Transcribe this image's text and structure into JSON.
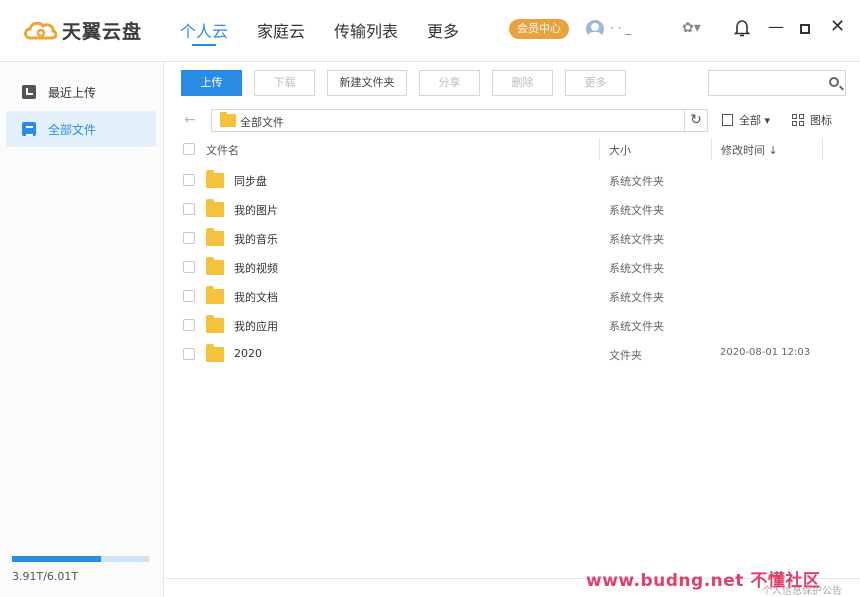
{
  "app": {
    "logo_text": "天翼云盘"
  },
  "nav": {
    "items": [
      "个人云",
      "家庭云",
      "传输列表",
      "更多"
    ]
  },
  "header": {
    "vip_label": "会员中心",
    "username": "· ·  _",
    "skin_icon": "✿▾",
    "min_icon": "—",
    "close_icon": "✕"
  },
  "sidebar": {
    "items": [
      {
        "label": "最近上传"
      },
      {
        "label": "全部文件"
      }
    ],
    "storage": {
      "text": "3.91T/6.01T",
      "used_fraction": 0.65
    }
  },
  "toolbar": {
    "upload": "上传",
    "download": "下载",
    "new_folder": "新建文件夹",
    "share": "分享",
    "delete": "删除",
    "more": "更多"
  },
  "path": {
    "current": "全部文件",
    "refresh_icon": "↻"
  },
  "view": {
    "filter_label": "全部 ▾",
    "mode_label": "图标"
  },
  "table": {
    "headers": {
      "name": "文件名",
      "size": "大小",
      "modified": "修改时间 ↓"
    },
    "rows": [
      {
        "name": "同步盘",
        "type": "系统文件夹",
        "time": ""
      },
      {
        "name": "我的图片",
        "type": "系统文件夹",
        "time": ""
      },
      {
        "name": "我的音乐",
        "type": "系统文件夹",
        "time": ""
      },
      {
        "name": "我的视频",
        "type": "系统文件夹",
        "time": ""
      },
      {
        "name": "我的文档",
        "type": "系统文件夹",
        "time": ""
      },
      {
        "name": "我的应用",
        "type": "系统文件夹",
        "time": ""
      },
      {
        "name": "2020",
        "type": "文件夹",
        "time": "2020-08-01 12:03"
      }
    ]
  },
  "watermark": {
    "text": "www.budng.net 不懂社区",
    "sub": "个人信息保护公告"
  }
}
